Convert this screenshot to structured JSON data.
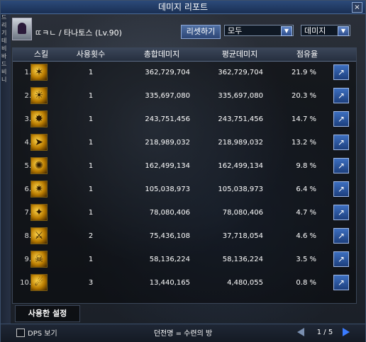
{
  "window": {
    "title": "데미지 리포트",
    "close_label": "×"
  },
  "left_strip": {
    "labels": [
      "드리기",
      "테비",
      "바드",
      "비니"
    ]
  },
  "header": {
    "character_name": "ㄸㅋㄴ / 타나토스 (Lv.90)",
    "reset_button_label": "리셋하기",
    "filter_all": "모두",
    "filter_damage": "데미지"
  },
  "table": {
    "headers": {
      "skill": "스킬",
      "use_count": "사용횟수",
      "total_damage": "총합데미지",
      "avg_damage": "평균데미지",
      "share": "점유율"
    },
    "rows": [
      {
        "num": "1.",
        "uses": "1",
        "total": "362,729,704",
        "avg": "362,729,704",
        "share": "21.9 %",
        "icon": "skill-icon-1"
      },
      {
        "num": "2.",
        "uses": "1",
        "total": "335,697,080",
        "avg": "335,697,080",
        "share": "20.3 %",
        "icon": "skill-icon-2"
      },
      {
        "num": "3.",
        "uses": "1",
        "total": "243,751,456",
        "avg": "243,751,456",
        "share": "14.7 %",
        "icon": "skill-icon-3"
      },
      {
        "num": "4.",
        "uses": "1",
        "total": "218,989,032",
        "avg": "218,989,032",
        "share": "13.2 %",
        "icon": "skill-icon-4"
      },
      {
        "num": "5.",
        "uses": "1",
        "total": "162,499,134",
        "avg": "162,499,134",
        "share": "9.8 %",
        "icon": "skill-icon-5"
      },
      {
        "num": "6.",
        "uses": "1",
        "total": "105,038,973",
        "avg": "105,038,973",
        "share": "6.4 %",
        "icon": "skill-icon-6"
      },
      {
        "num": "7.",
        "uses": "1",
        "total": "78,080,406",
        "avg": "78,080,406",
        "share": "4.7 %",
        "icon": "skill-icon-7"
      },
      {
        "num": "8.",
        "uses": "2",
        "total": "75,436,108",
        "avg": "37,718,054",
        "share": "4.6 %",
        "icon": "skill-icon-8"
      },
      {
        "num": "9.",
        "uses": "1",
        "total": "58,136,224",
        "avg": "58,136,224",
        "share": "3.5 %",
        "icon": "skill-icon-9"
      },
      {
        "num": "10.",
        "uses": "3",
        "total": "13,440,165",
        "avg": "4,480,055",
        "share": "0.8 %",
        "icon": "skill-icon-10"
      }
    ]
  },
  "footer": {
    "section_label": "사용한 설정",
    "dps_label": "DPS 보기",
    "dungeon_name": "던전명 = 수련의 방",
    "page": "1 / 5"
  },
  "colors": {
    "accent": "#3a7bff",
    "title_bg": "#2c4a79",
    "button_bg": "#2d4675"
  }
}
